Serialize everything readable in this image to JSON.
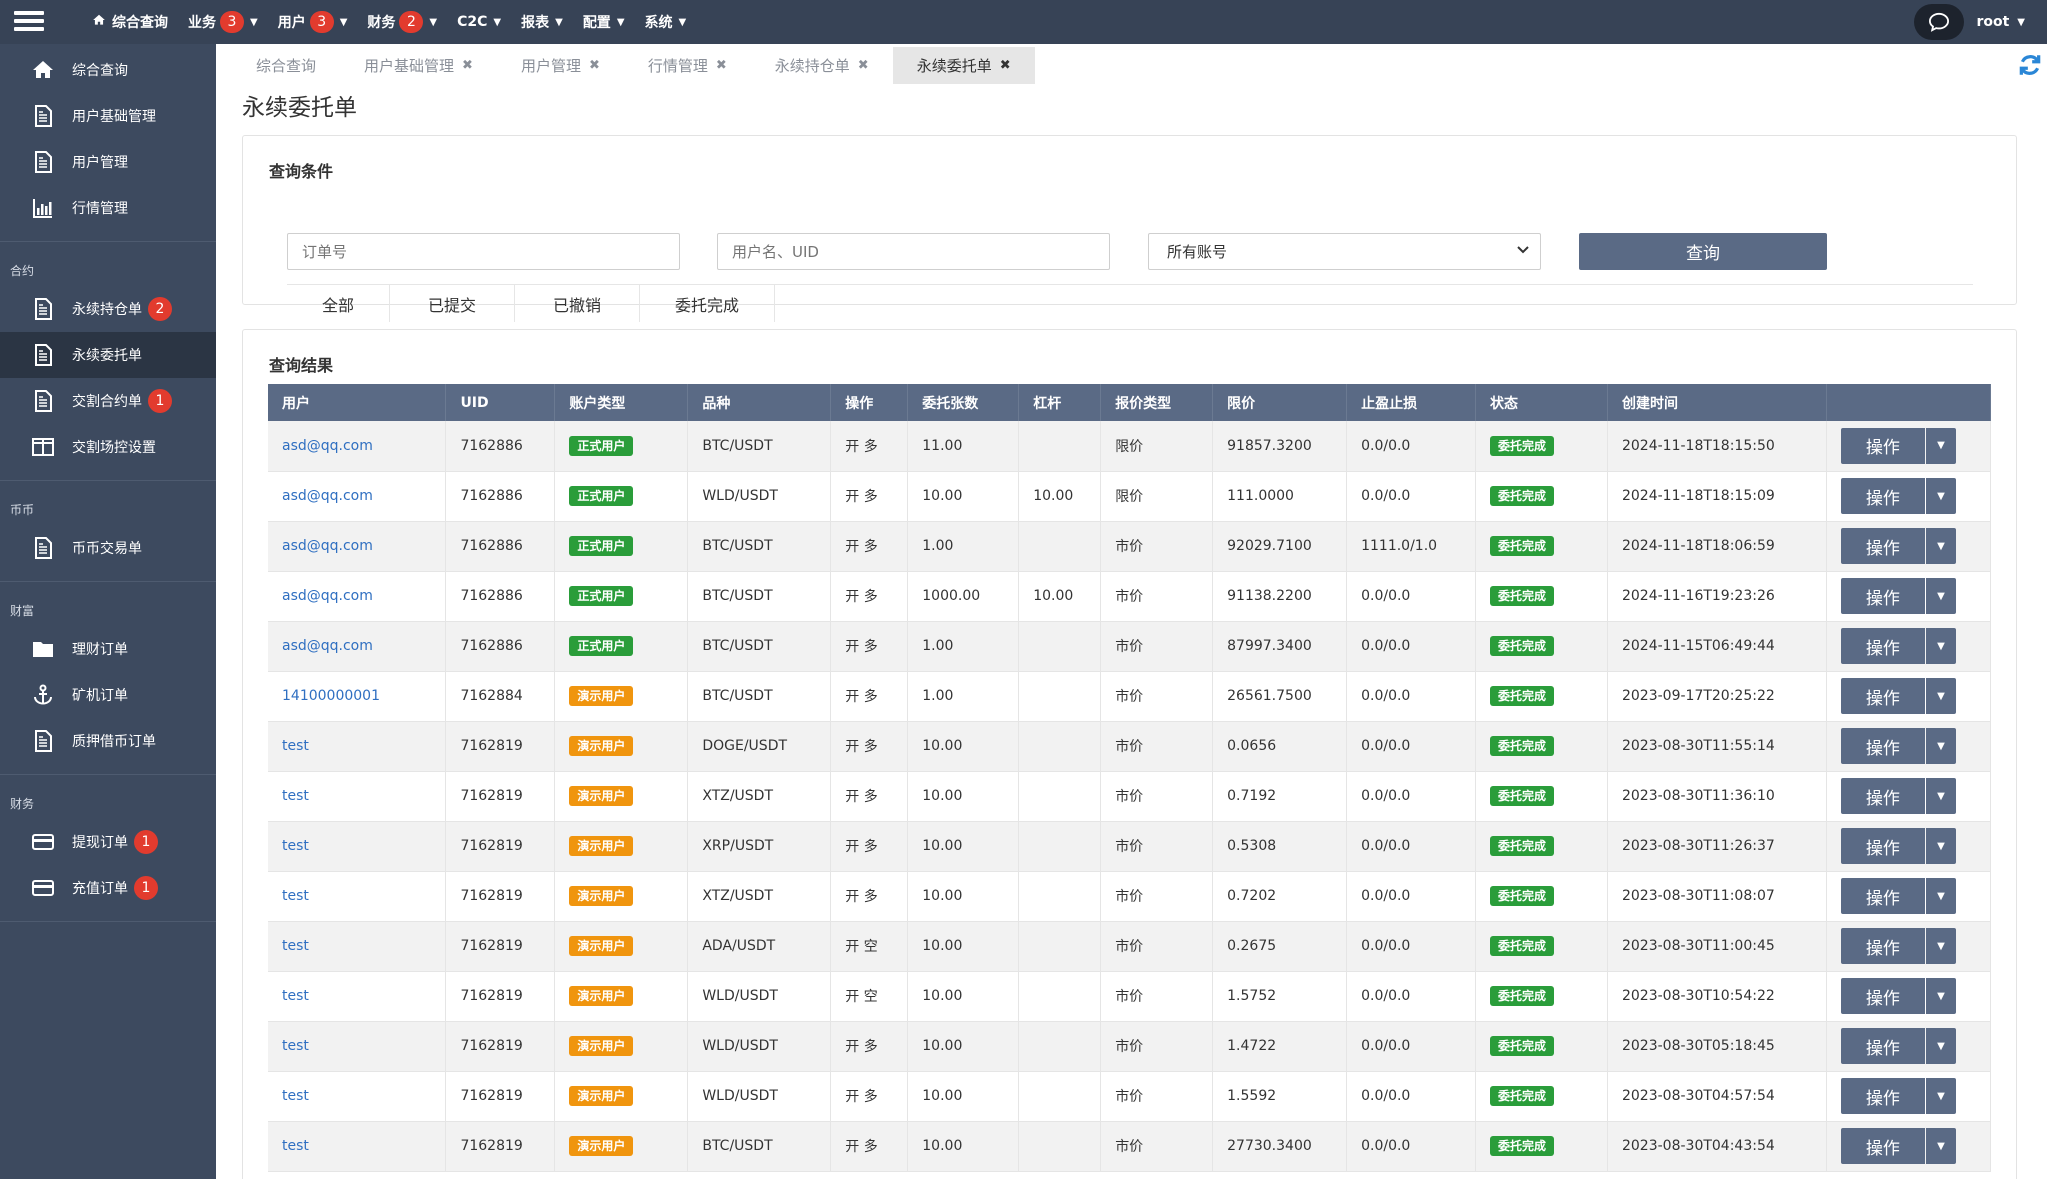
{
  "topnav": {
    "items": [
      {
        "label": "综合查询",
        "badge": null,
        "icon": "home-icon",
        "caret": false
      },
      {
        "label": "业务",
        "badge": "3",
        "caret": true
      },
      {
        "label": "用户",
        "badge": "3",
        "caret": true
      },
      {
        "label": "财务",
        "badge": "2",
        "caret": true
      },
      {
        "label": "C2C",
        "badge": null,
        "caret": true
      },
      {
        "label": "报表",
        "badge": null,
        "caret": true
      },
      {
        "label": "配置",
        "badge": null,
        "caret": true
      },
      {
        "label": "系统",
        "badge": null,
        "caret": true
      }
    ],
    "user": "root"
  },
  "sidebar": {
    "group0": [
      {
        "label": "综合查询",
        "icon": "home-icon"
      },
      {
        "label": "用户基础管理",
        "icon": "document-icon"
      },
      {
        "label": "用户管理",
        "icon": "document-icon"
      },
      {
        "label": "行情管理",
        "icon": "bar-chart-icon"
      }
    ],
    "group1_title": "合约",
    "group1": [
      {
        "label": "永续持仓单",
        "icon": "document-icon",
        "badge": "2"
      },
      {
        "label": "永续委托单",
        "icon": "document-icon",
        "badge": null,
        "active": true
      },
      {
        "label": "交割合约单",
        "icon": "document-icon",
        "badge": "1"
      },
      {
        "label": "交割场控设置",
        "icon": "columns-icon",
        "badge": null
      }
    ],
    "group2_title": "币币",
    "group2": [
      {
        "label": "币币交易单",
        "icon": "document-icon"
      }
    ],
    "group3_title": "财富",
    "group3": [
      {
        "label": "理财订单",
        "icon": "folder-icon"
      },
      {
        "label": "矿机订单",
        "icon": "anchor-icon"
      },
      {
        "label": "质押借币订单",
        "icon": "document-icon"
      }
    ],
    "group4_title": "财务",
    "group4": [
      {
        "label": "提现订单",
        "icon": "credit-card-icon",
        "badge": "1"
      },
      {
        "label": "充值订单",
        "icon": "credit-card-icon",
        "badge": "1"
      }
    ]
  },
  "tabs": [
    {
      "label": "综合查询",
      "closable": false,
      "active": false
    },
    {
      "label": "用户基础管理",
      "closable": true,
      "active": false
    },
    {
      "label": "用户管理",
      "closable": true,
      "active": false
    },
    {
      "label": "行情管理",
      "closable": true,
      "active": false
    },
    {
      "label": "永续持仓单",
      "closable": true,
      "active": false
    },
    {
      "label": "永续委托单",
      "closable": true,
      "active": true
    }
  ],
  "page_title": "永续委托单",
  "query": {
    "title": "查询条件",
    "order_placeholder": "订单号",
    "user_placeholder": "用户名、UID",
    "account_select": "所有账号",
    "query_button": "查询",
    "filters": [
      "全部",
      "已提交",
      "已撤销",
      "委托完成"
    ]
  },
  "results": {
    "title": "查询结果",
    "columns": [
      "用户",
      "UID",
      "账户类型",
      "品种",
      "操作",
      "委托张数",
      "杠杆",
      "报价类型",
      "限价",
      "止盈止损",
      "状态",
      "创建时间",
      ""
    ],
    "op_label": "操作",
    "rows": [
      {
        "user": "asd@qq.com",
        "uid": "7162886",
        "acct": "正式用户",
        "acct_type": "formal",
        "symbol": "BTC/USDT",
        "side": "开 多",
        "qty": "11.00",
        "lev": "",
        "ptype": "限价",
        "price": "91857.3200",
        "tpsl": "0.0/0.0",
        "status": "委托完成",
        "time": "2024-11-18T18:15:50"
      },
      {
        "user": "asd@qq.com",
        "uid": "7162886",
        "acct": "正式用户",
        "acct_type": "formal",
        "symbol": "WLD/USDT",
        "side": "开 多",
        "qty": "10.00",
        "lev": "10.00",
        "ptype": "限价",
        "price": "111.0000",
        "tpsl": "0.0/0.0",
        "status": "委托完成",
        "time": "2024-11-18T18:15:09"
      },
      {
        "user": "asd@qq.com",
        "uid": "7162886",
        "acct": "正式用户",
        "acct_type": "formal",
        "symbol": "BTC/USDT",
        "side": "开 多",
        "qty": "1.00",
        "lev": "",
        "ptype": "市价",
        "price": "92029.7100",
        "tpsl": "1111.0/1.0",
        "status": "委托完成",
        "time": "2024-11-18T18:06:59"
      },
      {
        "user": "asd@qq.com",
        "uid": "7162886",
        "acct": "正式用户",
        "acct_type": "formal",
        "symbol": "BTC/USDT",
        "side": "开 多",
        "qty": "1000.00",
        "lev": "10.00",
        "ptype": "市价",
        "price": "91138.2200",
        "tpsl": "0.0/0.0",
        "status": "委托完成",
        "time": "2024-11-16T19:23:26"
      },
      {
        "user": "asd@qq.com",
        "uid": "7162886",
        "acct": "正式用户",
        "acct_type": "formal",
        "symbol": "BTC/USDT",
        "side": "开 多",
        "qty": "1.00",
        "lev": "",
        "ptype": "市价",
        "price": "87997.3400",
        "tpsl": "0.0/0.0",
        "status": "委托完成",
        "time": "2024-11-15T06:49:44"
      },
      {
        "user": "14100000001",
        "uid": "7162884",
        "acct": "演示用户",
        "acct_type": "demo",
        "symbol": "BTC/USDT",
        "side": "开 多",
        "qty": "1.00",
        "lev": "",
        "ptype": "市价",
        "price": "26561.7500",
        "tpsl": "0.0/0.0",
        "status": "委托完成",
        "time": "2023-09-17T20:25:22"
      },
      {
        "user": "test",
        "uid": "7162819",
        "acct": "演示用户",
        "acct_type": "demo",
        "symbol": "DOGE/USDT",
        "side": "开 多",
        "qty": "10.00",
        "lev": "",
        "ptype": "市价",
        "price": "0.0656",
        "tpsl": "0.0/0.0",
        "status": "委托完成",
        "time": "2023-08-30T11:55:14"
      },
      {
        "user": "test",
        "uid": "7162819",
        "acct": "演示用户",
        "acct_type": "demo",
        "symbol": "XTZ/USDT",
        "side": "开 多",
        "qty": "10.00",
        "lev": "",
        "ptype": "市价",
        "price": "0.7192",
        "tpsl": "0.0/0.0",
        "status": "委托完成",
        "time": "2023-08-30T11:36:10"
      },
      {
        "user": "test",
        "uid": "7162819",
        "acct": "演示用户",
        "acct_type": "demo",
        "symbol": "XRP/USDT",
        "side": "开 多",
        "qty": "10.00",
        "lev": "",
        "ptype": "市价",
        "price": "0.5308",
        "tpsl": "0.0/0.0",
        "status": "委托完成",
        "time": "2023-08-30T11:26:37"
      },
      {
        "user": "test",
        "uid": "7162819",
        "acct": "演示用户",
        "acct_type": "demo",
        "symbol": "XTZ/USDT",
        "side": "开 多",
        "qty": "10.00",
        "lev": "",
        "ptype": "市价",
        "price": "0.7202",
        "tpsl": "0.0/0.0",
        "status": "委托完成",
        "time": "2023-08-30T11:08:07"
      },
      {
        "user": "test",
        "uid": "7162819",
        "acct": "演示用户",
        "acct_type": "demo",
        "symbol": "ADA/USDT",
        "side": "开 空",
        "qty": "10.00",
        "lev": "",
        "ptype": "市价",
        "price": "0.2675",
        "tpsl": "0.0/0.0",
        "status": "委托完成",
        "time": "2023-08-30T11:00:45"
      },
      {
        "user": "test",
        "uid": "7162819",
        "acct": "演示用户",
        "acct_type": "demo",
        "symbol": "WLD/USDT",
        "side": "开 空",
        "qty": "10.00",
        "lev": "",
        "ptype": "市价",
        "price": "1.5752",
        "tpsl": "0.0/0.0",
        "status": "委托完成",
        "time": "2023-08-30T10:54:22"
      },
      {
        "user": "test",
        "uid": "7162819",
        "acct": "演示用户",
        "acct_type": "demo",
        "symbol": "WLD/USDT",
        "side": "开 多",
        "qty": "10.00",
        "lev": "",
        "ptype": "市价",
        "price": "1.4722",
        "tpsl": "0.0/0.0",
        "status": "委托完成",
        "time": "2023-08-30T05:18:45"
      },
      {
        "user": "test",
        "uid": "7162819",
        "acct": "演示用户",
        "acct_type": "demo",
        "symbol": "WLD/USDT",
        "side": "开 多",
        "qty": "10.00",
        "lev": "",
        "ptype": "市价",
        "price": "1.5592",
        "tpsl": "0.0/0.0",
        "status": "委托完成",
        "time": "2023-08-30T04:57:54"
      },
      {
        "user": "test",
        "uid": "7162819",
        "acct": "演示用户",
        "acct_type": "demo",
        "symbol": "BTC/USDT",
        "side": "开 多",
        "qty": "10.00",
        "lev": "",
        "ptype": "市价",
        "price": "27730.3400",
        "tpsl": "0.0/0.0",
        "status": "委托完成",
        "time": "2023-08-30T04:43:54"
      }
    ]
  },
  "colors": {
    "topbar": "#374356",
    "sidebar": "#3d4a5f",
    "header_row": "#5a6a85",
    "badge_red": "#e23b2e",
    "tag_green": "#2a9d3a",
    "tag_orange": "#f0950e",
    "link_blue": "#2f6fc1"
  }
}
